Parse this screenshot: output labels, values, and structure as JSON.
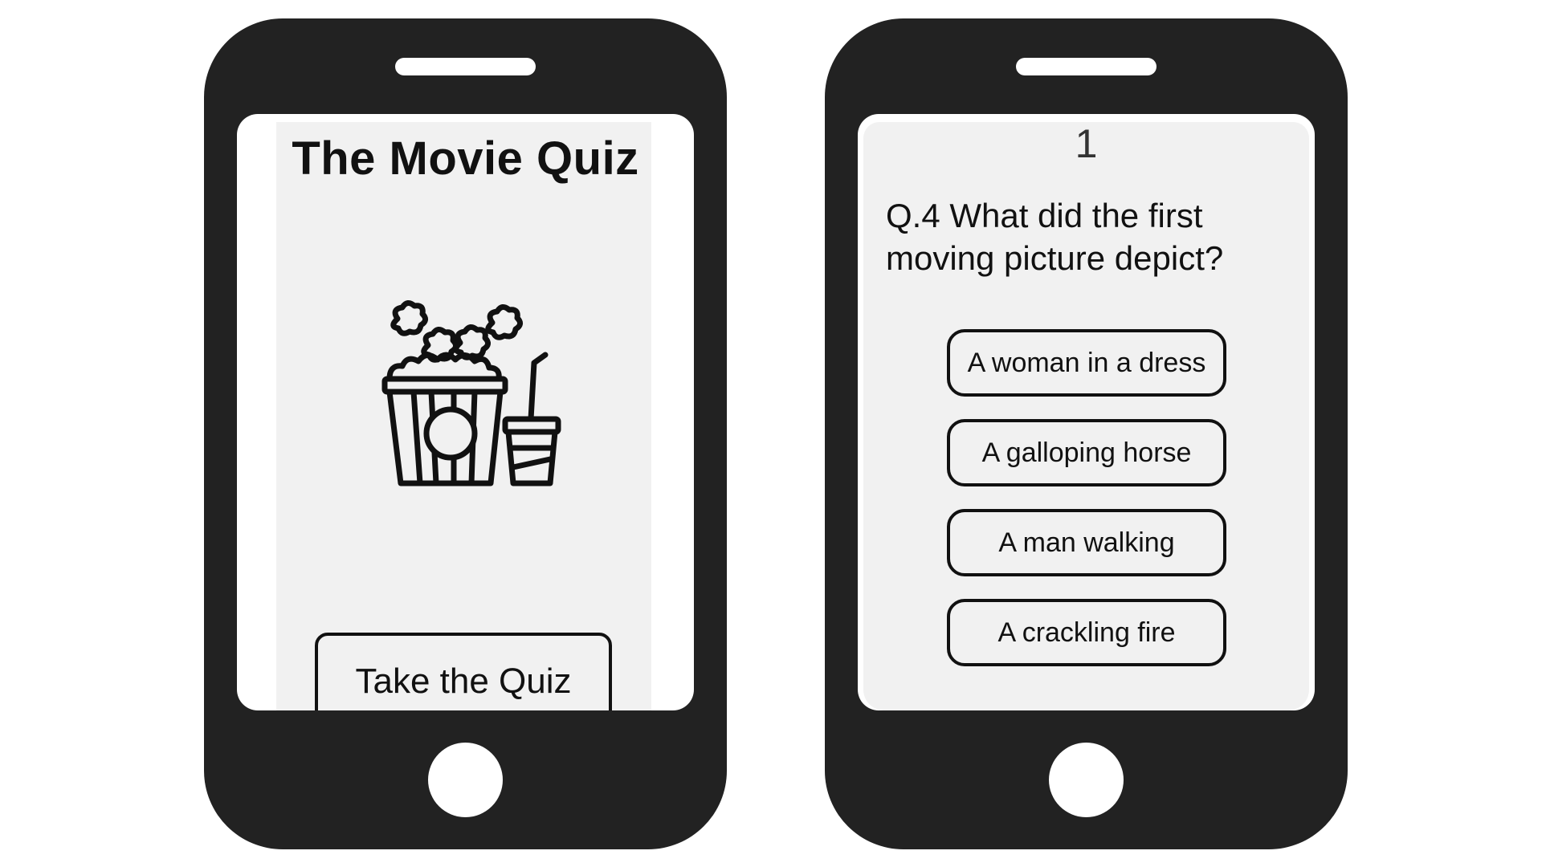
{
  "start_screen": {
    "title": "The Movie Quiz",
    "logo_icon": "popcorn-and-drink-icon",
    "start_button_label": "Take the Quiz"
  },
  "question_screen": {
    "question_number": "1",
    "question_text": "Q.4 What did the first moving picture depict?",
    "answers": [
      {
        "label": "A woman in a dress"
      },
      {
        "label": "A galloping horse"
      },
      {
        "label": "A man walking"
      },
      {
        "label": "A crackling fire"
      }
    ]
  },
  "colors": {
    "phone_body": "#222222",
    "screen_background": "#f1f1f1",
    "outline": "#111111"
  }
}
